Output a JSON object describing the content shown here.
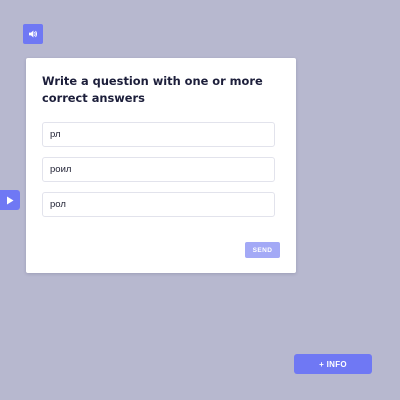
{
  "toolbar": {
    "sound_icon": "speaker-icon",
    "side_toggle_icon": "play-icon"
  },
  "card": {
    "title": "Write a question with one or more correct answers",
    "answers": [
      "рл",
      "роил",
      "рол"
    ],
    "send_label": "SEND"
  },
  "info_button": {
    "label": "+ INFO"
  },
  "colors": {
    "background": "#b7b8cf",
    "accent": "#6f78f4",
    "send_disabled": "#a3a9f6",
    "card": "#ffffff",
    "title_text": "#1c1e3a"
  }
}
